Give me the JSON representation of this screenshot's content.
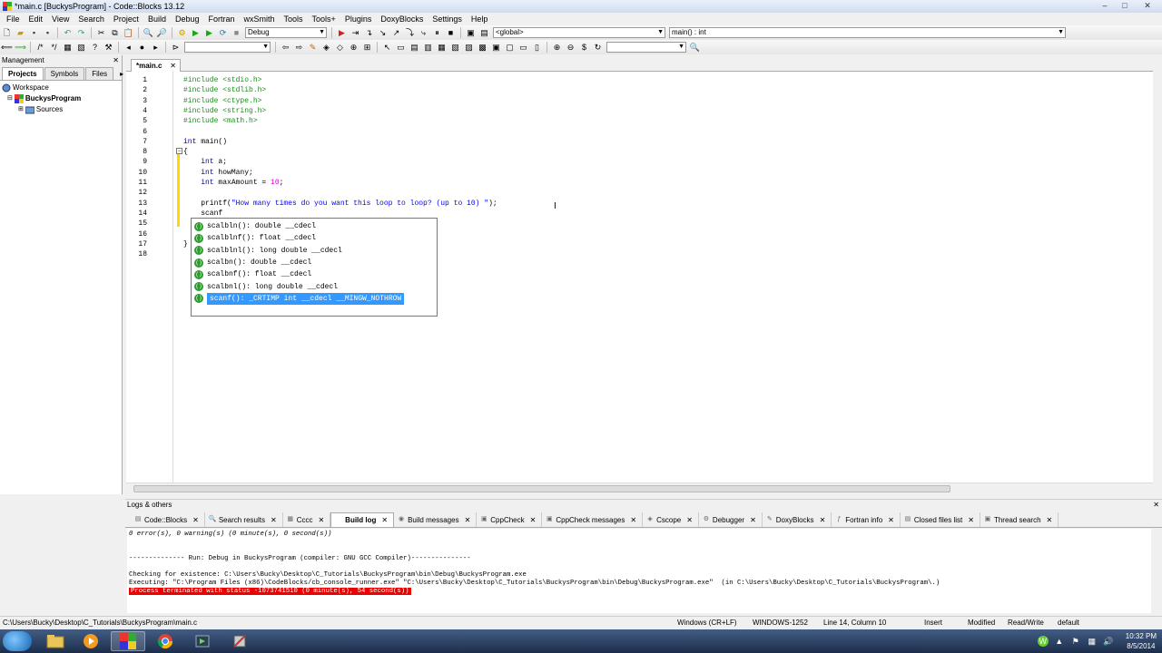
{
  "window": {
    "title": "*main.c [BuckysProgram] - Code::Blocks 13.12",
    "minimize": "–",
    "maximize": "□",
    "close": "✕"
  },
  "menu": [
    "File",
    "Edit",
    "View",
    "Search",
    "Project",
    "Build",
    "Debug",
    "Fortran",
    "wxSmith",
    "Tools",
    "Tools+",
    "Plugins",
    "DoxyBlocks",
    "Settings",
    "Help"
  ],
  "toolbar": {
    "build_target": "Debug",
    "scope": "<global>",
    "function": "main() : int"
  },
  "management": {
    "header": "Management",
    "tabs": [
      "Projects",
      "Symbols",
      "Files"
    ],
    "tree": {
      "workspace": "Workspace",
      "project": "BuckysProgram",
      "folder": "Sources"
    }
  },
  "editor": {
    "tab_label": "*main.c",
    "lines": [
      {
        "n": "1",
        "text": "#include <stdio.h>"
      },
      {
        "n": "2",
        "text": "#include <stdlib.h>"
      },
      {
        "n": "3",
        "text": "#include <ctype.h>"
      },
      {
        "n": "4",
        "text": "#include <string.h>"
      },
      {
        "n": "5",
        "text": "#include <math.h>"
      },
      {
        "n": "6",
        "text": ""
      },
      {
        "n": "7",
        "text": "int main()"
      },
      {
        "n": "8",
        "text": "{"
      },
      {
        "n": "9",
        "text": "    int a;"
      },
      {
        "n": "10",
        "text": "    int howMany;"
      },
      {
        "n": "11",
        "text": "    int maxAmount = 10;"
      },
      {
        "n": "12",
        "text": ""
      },
      {
        "n": "13",
        "text": "    printf(\"How many times do you want this loop to loop? (up to 10) \");"
      },
      {
        "n": "14",
        "text": "    scanf"
      },
      {
        "n": "15",
        "text": ""
      },
      {
        "n": "16",
        "text": ""
      },
      {
        "n": "17",
        "text": "}"
      },
      {
        "n": "18",
        "text": ""
      }
    ]
  },
  "autocomplete": {
    "items": [
      "scalbln(): double __cdecl",
      "scalblnf(): float __cdecl",
      "scalblnl(): long double __cdecl",
      "scalbn(): double __cdecl",
      "scalbnf(): float __cdecl",
      "scalbnl(): long double __cdecl",
      "scanf(): _CRTIMP int __cdecl __MINGW_NOTHROW"
    ],
    "selected_index": 6
  },
  "logs": {
    "header": "Logs & others",
    "tabs": [
      "Code::Blocks",
      "Search results",
      "Cccc",
      "Build log",
      "Build messages",
      "CppCheck",
      "CppCheck messages",
      "Cscope",
      "Debugger",
      "DoxyBlocks",
      "Fortran info",
      "Closed files list",
      "Thread search"
    ],
    "active_tab": "Build log",
    "lines": [
      "0 error(s), 0 warning(s) (0 minute(s), 0 second(s))",
      "",
      "",
      "-------------- Run: Debug in BuckysProgram (compiler: GNU GCC Compiler)---------------",
      "",
      "Checking for existence: C:\\Users\\Bucky\\Desktop\\C_Tutorials\\BuckysProgram\\bin\\Debug\\BuckysProgram.exe",
      "Executing: \"C:\\Program Files (x86)\\CodeBlocks/cb_console_runner.exe\" \"C:\\Users\\Bucky\\Desktop\\C_Tutorials\\BuckysProgram\\bin\\Debug\\BuckysProgram.exe\"  (in C:\\Users\\Bucky\\Desktop\\C_Tutorials\\BuckysProgram\\.)"
    ],
    "error_line": "Process terminated with status -1073741510 (0 minute(s), 54 second(s))"
  },
  "status": {
    "path": "C:\\Users\\Bucky\\Desktop\\C_Tutorials\\BuckysProgram\\main.c",
    "eol": "Windows (CR+LF)",
    "encoding": "WINDOWS-1252",
    "position": "Line 14, Column 10",
    "mode": "Insert",
    "modified": "Modified",
    "access": "Read/Write",
    "profile": "default"
  },
  "taskbar": {
    "time": "10:32 PM",
    "date": "8/5/2014"
  }
}
